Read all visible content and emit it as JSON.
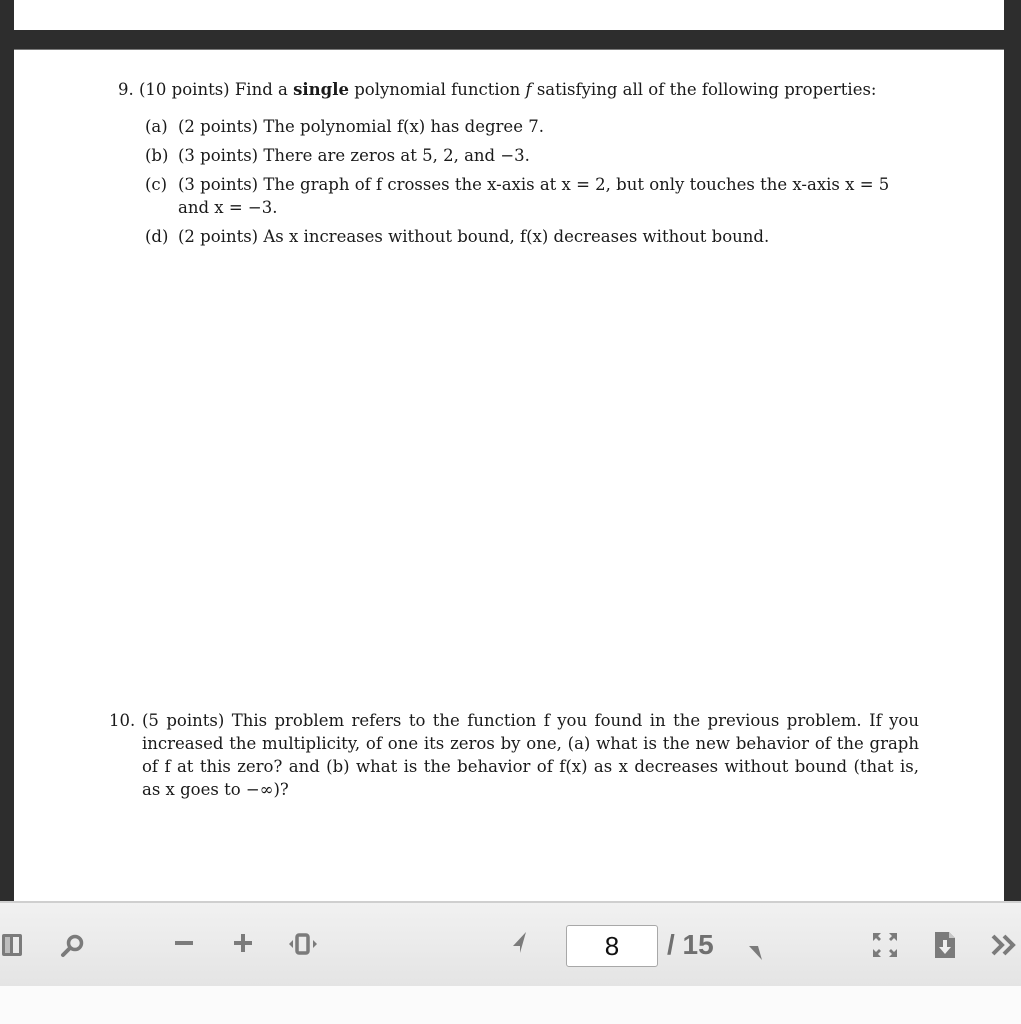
{
  "document": {
    "q9": {
      "number": "9.",
      "intro_before": "(10 points) Find a ",
      "intro_bold": "single",
      "intro_after": " polynomial function ",
      "intro_var": "f",
      "intro_end": " satisfying all of the following properties:",
      "parts": [
        {
          "label": "(a)",
          "text": "(2 points) The polynomial f(x) has degree 7."
        },
        {
          "label": "(b)",
          "text": "(3 points) There are zeros at 5, 2, and −3."
        },
        {
          "label": "(c)",
          "text": "(3 points) The graph of f crosses the x-axis at x = 2, but only touches the x-axis x = 5",
          "text_cont": "and x = −3."
        },
        {
          "label": "(d)",
          "text": "(2 points) As x increases without bound, f(x) decreases without bound."
        }
      ]
    },
    "q10": {
      "number": "10.",
      "text": "(5 points) This problem refers to the function f you found in the previous problem. If you increased the multiplicity, of one its zeros by one, (a) what is the new behavior of the graph of f at this zero? and (b) what is the behavior of f(x) as x decreases without bound (that is, as x goes to −∞)?"
    }
  },
  "toolbar": {
    "icons": {
      "sidebar": "sidebar-toggle-icon",
      "search": "search-icon",
      "zoom_out": "zoom-out-icon",
      "zoom_in": "zoom-in-icon",
      "fit": "fit-page-icon",
      "prev": "previous-page-icon",
      "next": "next-page-icon",
      "fullscreen": "fullscreen-icon",
      "download": "download-icon",
      "more": "more-icon"
    },
    "current_page": "8",
    "total_pages": "/ 15",
    "zoom_out_glyph": "−",
    "zoom_in_glyph": "+",
    "more_glyph": "»"
  }
}
